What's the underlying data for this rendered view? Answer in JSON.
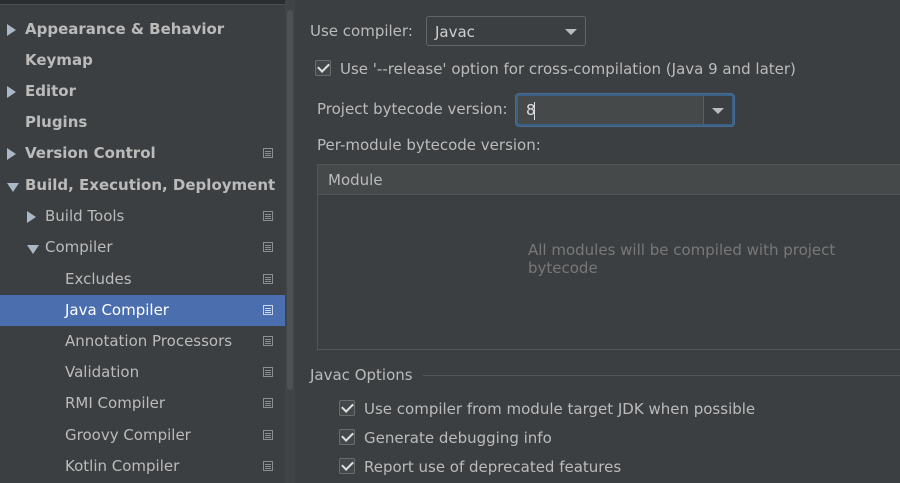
{
  "sidebar": {
    "items": [
      {
        "label": "Appearance & Behavior",
        "bold": true,
        "arrow": "right",
        "indent": 0,
        "icon": false,
        "selected": false
      },
      {
        "label": "Keymap",
        "bold": true,
        "arrow": "none",
        "indent": 0,
        "icon": false,
        "selected": false
      },
      {
        "label": "Editor",
        "bold": true,
        "arrow": "right",
        "indent": 0,
        "icon": false,
        "selected": false
      },
      {
        "label": "Plugins",
        "bold": true,
        "arrow": "none",
        "indent": 0,
        "icon": false,
        "selected": false
      },
      {
        "label": "Version Control",
        "bold": true,
        "arrow": "right",
        "indent": 0,
        "icon": true,
        "selected": false
      },
      {
        "label": "Build, Execution, Deployment",
        "bold": true,
        "arrow": "down",
        "indent": 0,
        "icon": false,
        "selected": false
      },
      {
        "label": "Build Tools",
        "bold": false,
        "arrow": "right",
        "indent": 1,
        "icon": true,
        "selected": false
      },
      {
        "label": "Compiler",
        "bold": false,
        "arrow": "down",
        "indent": 1,
        "icon": true,
        "selected": false
      },
      {
        "label": "Excludes",
        "bold": false,
        "arrow": "none",
        "indent": 2,
        "icon": true,
        "selected": false
      },
      {
        "label": "Java Compiler",
        "bold": false,
        "arrow": "none",
        "indent": 2,
        "icon": true,
        "selected": true
      },
      {
        "label": "Annotation Processors",
        "bold": false,
        "arrow": "none",
        "indent": 2,
        "icon": true,
        "selected": false
      },
      {
        "label": "Validation",
        "bold": false,
        "arrow": "none",
        "indent": 2,
        "icon": true,
        "selected": false
      },
      {
        "label": "RMI Compiler",
        "bold": false,
        "arrow": "none",
        "indent": 2,
        "icon": true,
        "selected": false
      },
      {
        "label": "Groovy Compiler",
        "bold": false,
        "arrow": "none",
        "indent": 2,
        "icon": true,
        "selected": false
      },
      {
        "label": "Kotlin Compiler",
        "bold": false,
        "arrow": "none",
        "indent": 2,
        "icon": true,
        "selected": false
      }
    ]
  },
  "compiler": {
    "label": "Use compiler:",
    "value": "Javac"
  },
  "release_option": {
    "checked": true,
    "label": "Use '--release' option for cross-compilation (Java 9 and later)"
  },
  "bytecode": {
    "label": "Project bytecode version:",
    "value": "8"
  },
  "per_module": {
    "label": "Per-module bytecode version:",
    "column_header": "Module",
    "empty_text": "All modules will be compiled with project bytecode"
  },
  "javac_options": {
    "title": "Javac Options",
    "checkboxes": [
      {
        "label": "Use compiler from module target JDK when possible",
        "checked": true
      },
      {
        "label": "Generate debugging info",
        "checked": true
      },
      {
        "label": "Report use of deprecated features",
        "checked": true
      }
    ]
  },
  "colors": {
    "background": "#3c3f41",
    "selection": "#4b6eaf",
    "text": "#bbbbbb",
    "focus_border": "#3d6185"
  },
  "icons": {
    "expand": "triangle-right-icon",
    "collapse": "triangle-down-icon",
    "project_settings": "project-level-icon",
    "dropdown": "chevron-down-icon",
    "check": "checkmark-icon"
  }
}
